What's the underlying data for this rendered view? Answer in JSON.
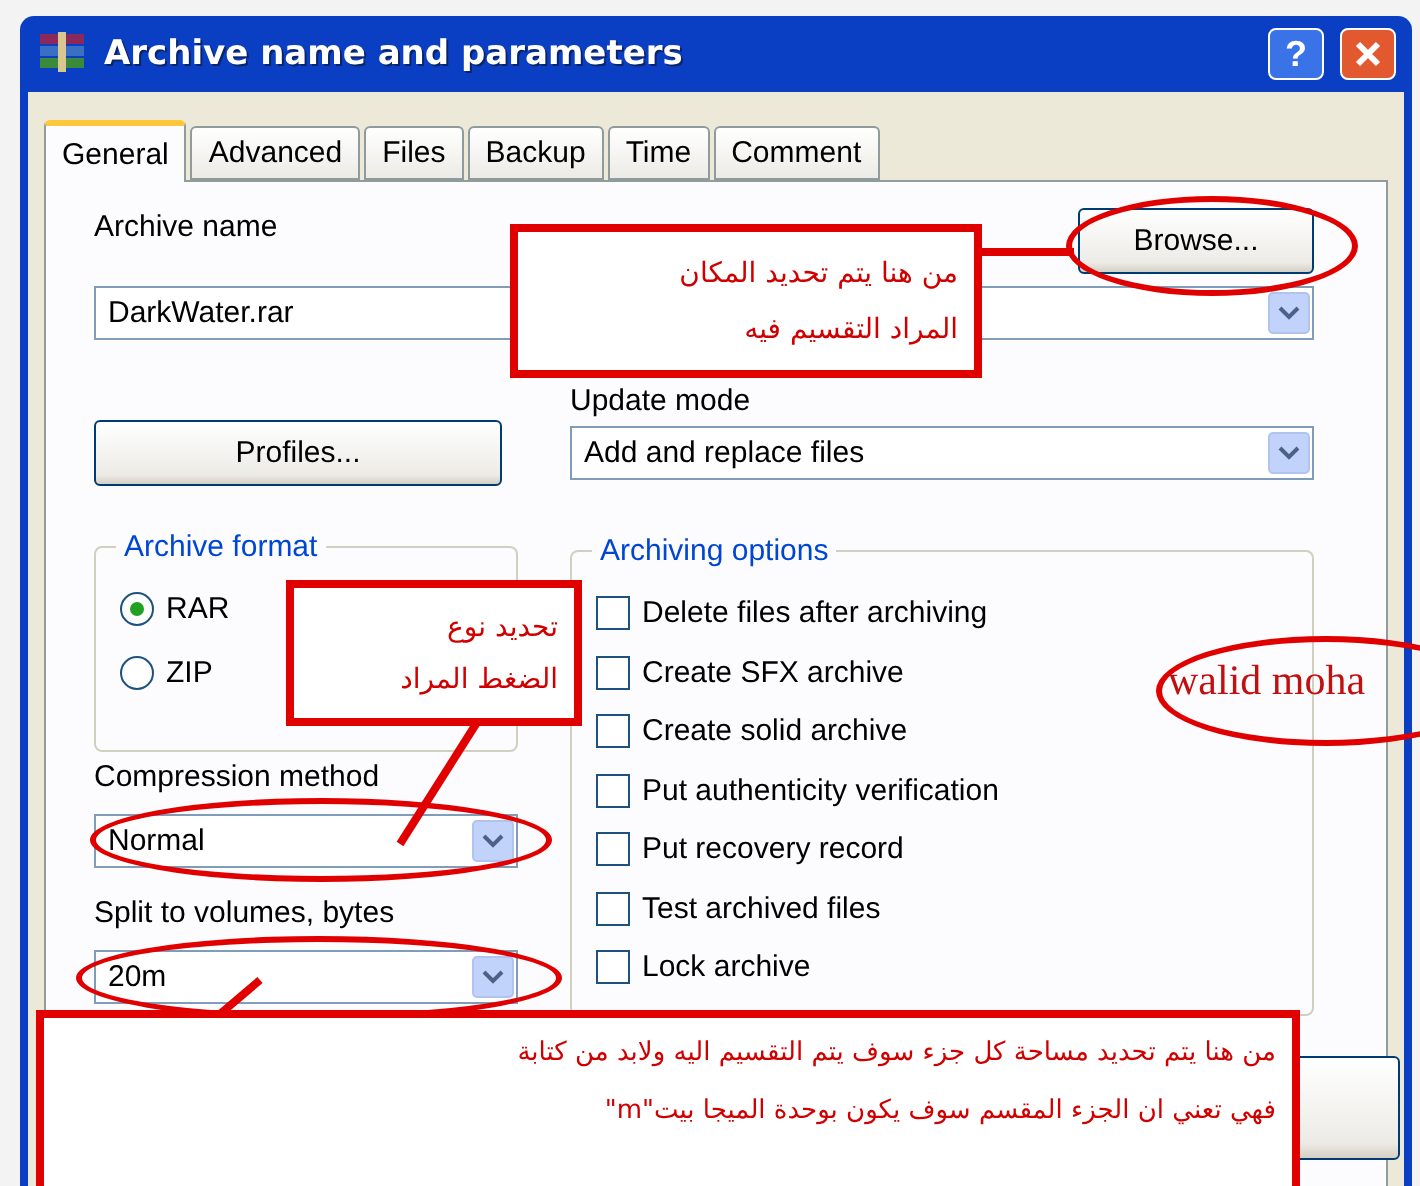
{
  "window": {
    "title": "Archive name and parameters",
    "help_button": "?"
  },
  "tabs": [
    {
      "label": "General",
      "selected": true
    },
    {
      "label": "Advanced",
      "selected": false
    },
    {
      "label": "Files",
      "selected": false
    },
    {
      "label": "Backup",
      "selected": false
    },
    {
      "label": "Time",
      "selected": false
    },
    {
      "label": "Comment",
      "selected": false
    }
  ],
  "archive_name": {
    "label": "Archive name",
    "value": "DarkWater.rar",
    "browse": "Browse..."
  },
  "profiles": "Profiles...",
  "update_mode": {
    "label": "Update mode",
    "value": "Add and replace files"
  },
  "archive_format": {
    "title": "Archive format",
    "options": [
      {
        "label": "RAR",
        "selected": true
      },
      {
        "label": "ZIP",
        "selected": false
      }
    ]
  },
  "compression": {
    "label": "Compression method",
    "value": "Normal"
  },
  "split": {
    "label": "Split to volumes, bytes",
    "value": "20m"
  },
  "archiving_options": {
    "title": "Archiving options",
    "items": [
      {
        "label": "Delete files after archiving",
        "checked": false
      },
      {
        "label": "Create SFX archive",
        "checked": false
      },
      {
        "label": "Create solid archive",
        "checked": false
      },
      {
        "label": "Put authenticity verification",
        "checked": false
      },
      {
        "label": "Put recovery record",
        "checked": false
      },
      {
        "label": "Test archived files",
        "checked": false
      },
      {
        "label": "Lock archive",
        "checked": false
      }
    ]
  },
  "annotations": [
    {
      "kind": "box",
      "lines": [
        "من هنا يتم تحديد المكان",
        "المراد التقسيم فيه"
      ]
    },
    {
      "kind": "oval",
      "lines": [
        "walid moha"
      ]
    },
    {
      "kind": "box",
      "lines": [
        "تحديد نوع",
        "الضغط المراد"
      ]
    },
    {
      "kind": "box",
      "lines": [
        "من هنا يتم تحديد مساحة كل جزء سوف يتم التقسيم اليه ولابد من كتابة",
        "فهي تعني ان الجزء المقسم سوف يكون بوحدة الميجا بيت\"m\""
      ]
    }
  ]
}
